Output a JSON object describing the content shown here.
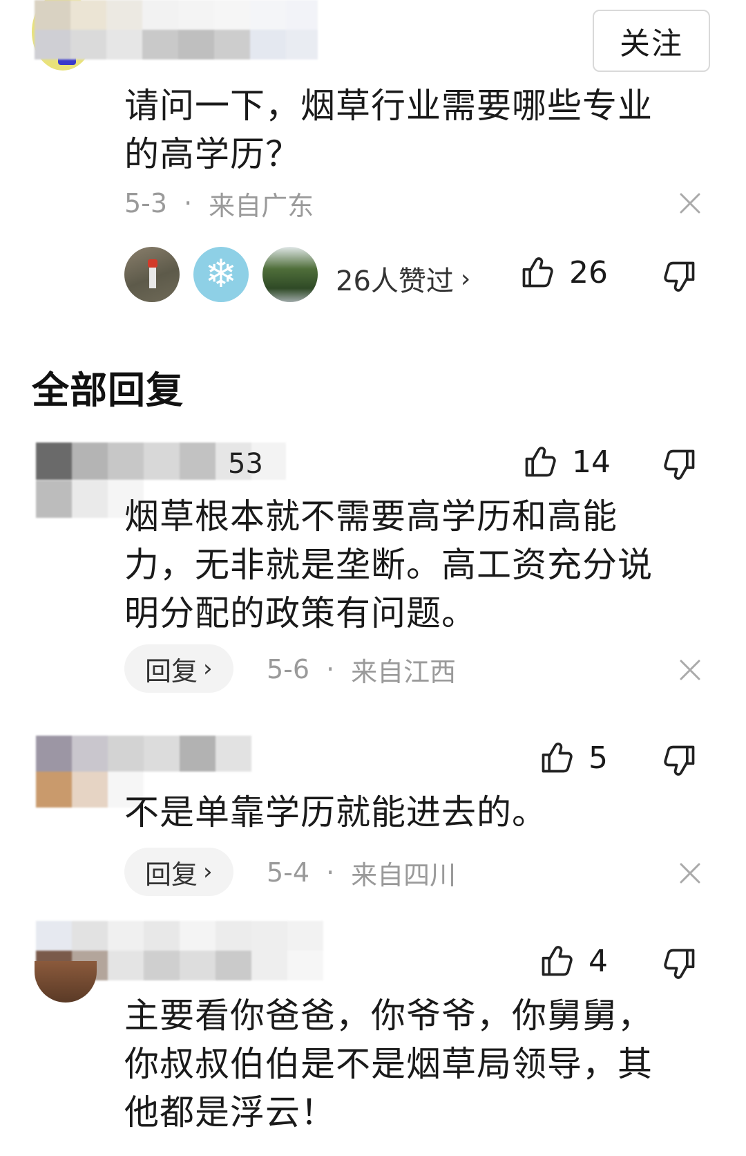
{
  "post": {
    "follow_label": "关注",
    "text_line1": "请问一下，烟草行业需要哪些专业",
    "text_line2": "的高学历？",
    "date": "5-3",
    "location": "来自广东",
    "liked_by_label": "26人赞过",
    "like_count": "26"
  },
  "replies_section": {
    "title": "全部回复"
  },
  "replies": [
    {
      "name_tail": "53",
      "like_count": "14",
      "lines": [
        "烟草根本就不需要高学历和高能",
        "力，无非就是垄断。高工资充分说",
        "明分配的政策有问题。"
      ],
      "reply_label": "回复",
      "date": "5-6",
      "location": "来自江西"
    },
    {
      "like_count": "5",
      "lines": [
        "不是单靠学历就能进去的。"
      ],
      "reply_label": "回复",
      "date": "5-4",
      "location": "来自四川"
    },
    {
      "like_count": "4",
      "lines": [
        "主要看你爸爸，你爷爷，你舅舅，",
        "你叔叔伯伯是不是烟草局领导，其",
        "他都是浮云！"
      ]
    }
  ],
  "icons": {
    "close": "close-icon",
    "like": "thumbs-up-icon",
    "dislike": "thumbs-down-icon",
    "chevron": "chevron-right-icon"
  }
}
